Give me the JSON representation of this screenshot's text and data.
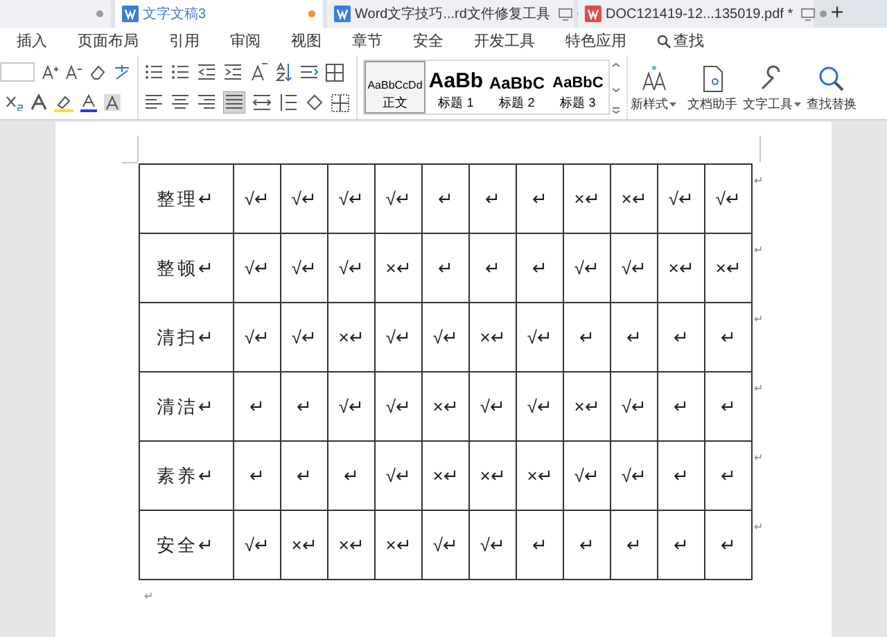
{
  "tabs": [
    {
      "selected": false,
      "dot": true
    },
    {
      "title": "文字文稿3",
      "kind": "doc",
      "selected": true,
      "unsaved": true
    },
    {
      "title": "Word文字技巧...rd文件修复工具",
      "kind": "doc",
      "selected": false,
      "unsaved": false
    },
    {
      "title": "DOC121419-12...135019.pdf *",
      "kind": "pdf",
      "selected": false,
      "unsaved": false
    }
  ],
  "new_tab": "+",
  "menu": [
    "插入",
    "页面布局",
    "引用",
    "审阅",
    "视图",
    "章节",
    "安全",
    "开发工具",
    "特色应用"
  ],
  "menu_search": "查找",
  "styles": [
    {
      "sample": "AaBbCcDd",
      "label": "正文",
      "selected": true
    },
    {
      "sample": "AaBb",
      "label": "标题 1",
      "selected": false
    },
    {
      "sample": "AaBbC",
      "label": "标题 2",
      "selected": false
    },
    {
      "sample": "AaBbC",
      "label": "标题 3",
      "selected": false
    }
  ],
  "ribbon_buttons": [
    {
      "label": "新样式",
      "kind": "styles",
      "dropdown": true
    },
    {
      "label": "文档助手",
      "kind": "doc",
      "dropdown": false
    },
    {
      "label": "文字工具",
      "kind": "wrench",
      "dropdown": true
    },
    {
      "label": "查找替换",
      "kind": "search",
      "dropdown": false
    }
  ],
  "table": {
    "rows": [
      {
        "label": "整理↵",
        "cells": [
          "√↵",
          "√↵",
          "√↵",
          "√↵",
          "↵",
          "↵",
          "↵",
          "×↵",
          "×↵",
          "√↵",
          "√↵"
        ],
        "end_mark": "↵"
      },
      {
        "label": "整顿↵",
        "cells": [
          "√↵",
          "√↵",
          "√↵",
          "×↵",
          "↵",
          "↵",
          "↵",
          "√↵",
          "√↵",
          "×↵",
          "×↵"
        ],
        "end_mark": "↵"
      },
      {
        "label": "清扫↵",
        "cells": [
          "√↵",
          "√↵",
          "×↵",
          "√↵",
          "√↵",
          "×↵",
          "√↵",
          "↵",
          "↵",
          "↵",
          "↵"
        ],
        "end_mark": "↵"
      },
      {
        "label": "清洁↵",
        "cells": [
          "↵",
          "↵",
          "√↵",
          "√↵",
          "×↵",
          "√↵",
          "√↵",
          "×↵",
          "√↵",
          "↵",
          "↵"
        ],
        "end_mark": "↵"
      },
      {
        "label": "素养↵",
        "cells": [
          "↵",
          "↵",
          "↵",
          "√↵",
          "×↵",
          "×↵",
          "×↵",
          "√↵",
          "√↵",
          "↵",
          "↵"
        ],
        "end_mark": "↵"
      },
      {
        "label": "安全↵",
        "cells": [
          "√↵",
          "×↵",
          "×↵",
          "×↵",
          "√↵",
          "√↵",
          "↵",
          "↵",
          "↵",
          "↵",
          "↵"
        ],
        "end_mark": "↵"
      }
    ]
  },
  "after_table_mark": "↵"
}
